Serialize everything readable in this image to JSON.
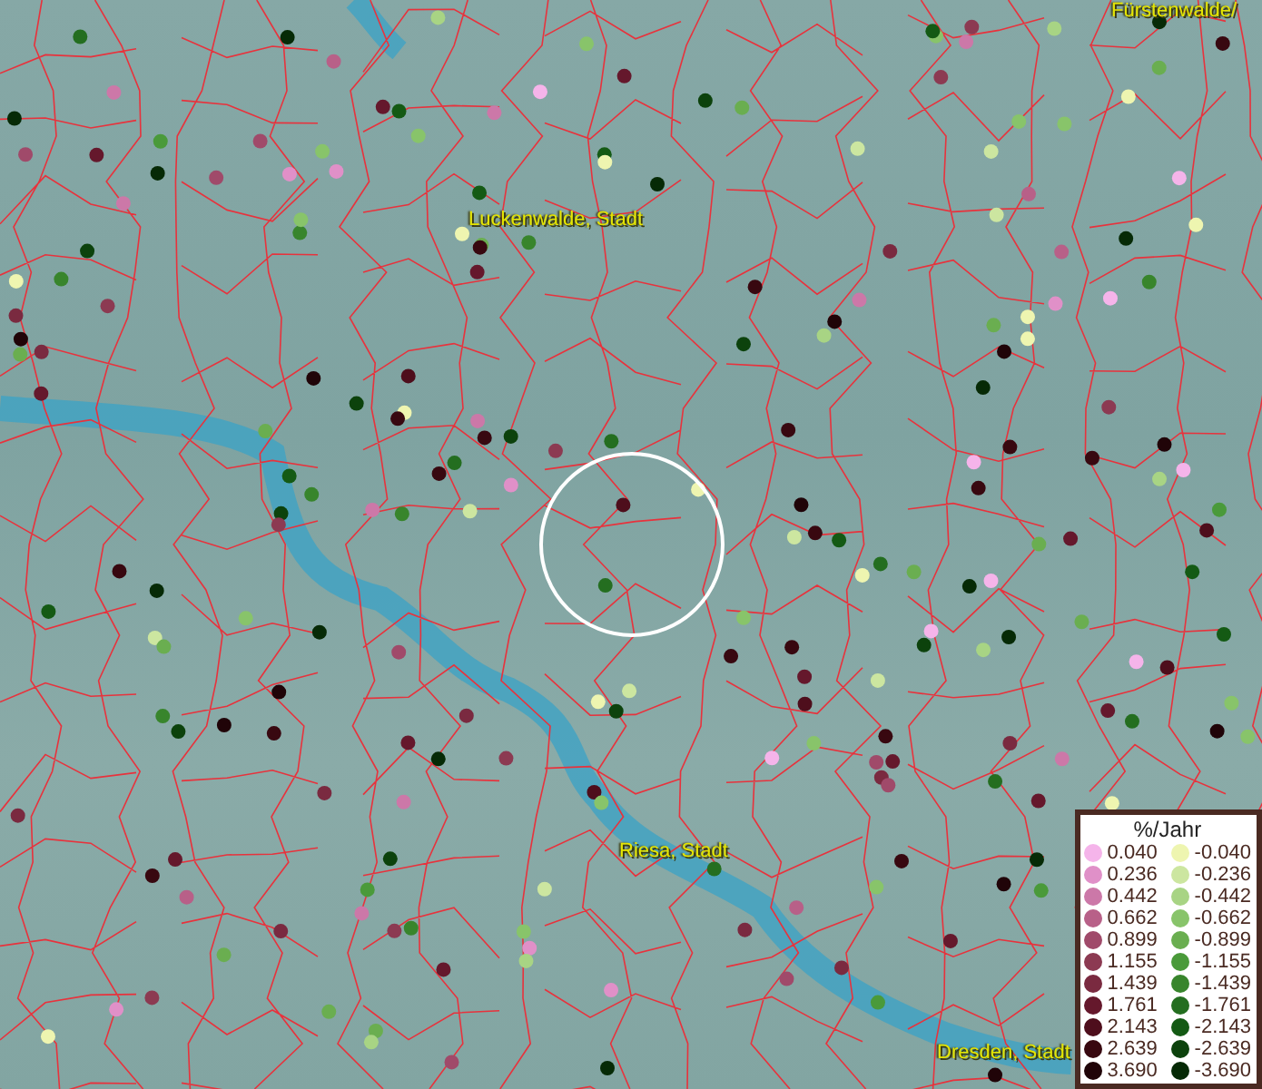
{
  "map": {
    "places": [
      {
        "name": "Fürstenwalde/"
      },
      {
        "name": "Luckenwalde, Stadt"
      },
      {
        "name": "Riesa, Stadt"
      },
      {
        "name": "Dresden, Stadt"
      }
    ]
  },
  "legend": {
    "title": "%/Jahr",
    "positive": [
      {
        "label": "0.040",
        "color": "#f5b4ea"
      },
      {
        "label": "0.236",
        "color": "#e090c8"
      },
      {
        "label": "0.442",
        "color": "#cc78a8"
      },
      {
        "label": "0.662",
        "color": "#b86088"
      },
      {
        "label": "0.899",
        "color": "#a04a6a"
      },
      {
        "label": "1.155",
        "color": "#8c3a52"
      },
      {
        "label": "1.439",
        "color": "#7a2a40"
      },
      {
        "label": "1.761",
        "color": "#65182c"
      },
      {
        "label": "2.143",
        "color": "#4e0e1c"
      },
      {
        "label": "2.639",
        "color": "#380810"
      },
      {
        "label": "3.690",
        "color": "#200408"
      }
    ],
    "negative": [
      {
        "label": "-0.040",
        "color": "#eef5b0"
      },
      {
        "label": "-0.236",
        "color": "#cce6a0"
      },
      {
        "label": "-0.442",
        "color": "#a8d484"
      },
      {
        "label": "-0.662",
        "color": "#88c46a"
      },
      {
        "label": "-0.899",
        "color": "#6aae50"
      },
      {
        "label": "-1.155",
        "color": "#4a9a3a"
      },
      {
        "label": "-1.439",
        "color": "#38852c"
      },
      {
        "label": "-1.761",
        "color": "#246e20"
      },
      {
        "label": "-2.143",
        "color": "#145a14"
      },
      {
        "label": "-2.639",
        "color": "#0c420c"
      },
      {
        "label": "-3.690",
        "color": "#062a06"
      }
    ]
  }
}
